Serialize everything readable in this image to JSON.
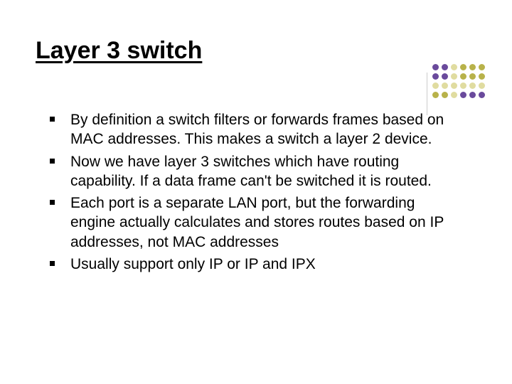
{
  "title": "Layer 3 switch",
  "bullets": [
    "By definition a switch filters or forwards frames based on MAC addresses. This makes a switch a layer 2 device.",
    "Now we have layer 3 switches which have routing capability. If a data frame can't be switched it is routed.",
    "Each port is a separate LAN port, but the forwarding engine actually calculates and stores routes based on IP addresses, not MAC addresses",
    "Usually support only IP or IP and IPX"
  ],
  "deco_colors": {
    "purple": "#6a4a9c",
    "olive": "#b8b24a",
    "light": "#e0dca0"
  }
}
